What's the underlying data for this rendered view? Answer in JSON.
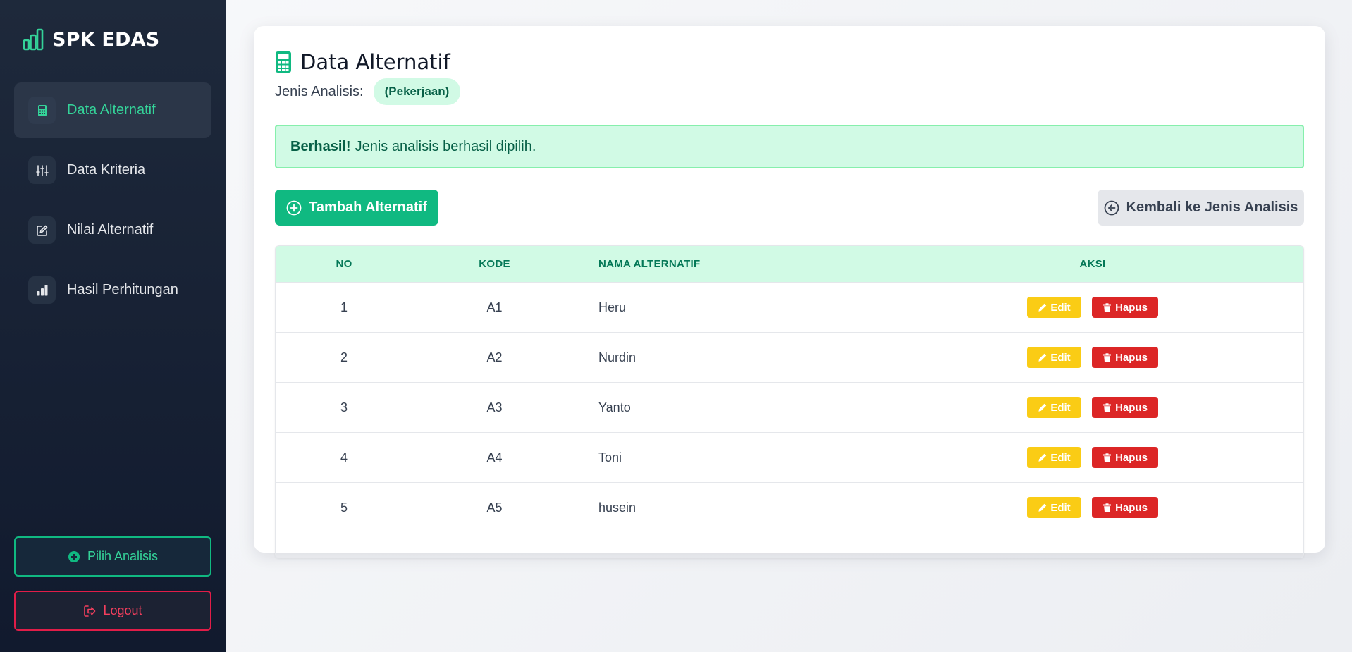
{
  "brand": {
    "name": "SPK EDAS",
    "icon": "bar-chart-icon"
  },
  "sidebar": {
    "items": [
      {
        "label": "Data Alternatif",
        "icon": "calculator-icon",
        "active": true
      },
      {
        "label": "Data Kriteria",
        "icon": "sliders-icon",
        "active": false
      },
      {
        "label": "Nilai Alternatif",
        "icon": "edit-icon",
        "active": false
      },
      {
        "label": "Hasil Perhitungan",
        "icon": "chart-bar-icon",
        "active": false
      }
    ],
    "pilih_label": "Pilih Analisis",
    "logout_label": "Logout"
  },
  "main": {
    "title": "Data Alternatif",
    "jenis_label": "Jenis Analisis:",
    "jenis_value": "(Pekerjaan)",
    "alert_strong": "Berhasil!",
    "alert_text": "Jenis analisis berhasil dipilih.",
    "tambah_label": "Tambah Alternatif",
    "kembali_label": "Kembali ke Jenis Analisis"
  },
  "table": {
    "headers": {
      "no": "NO",
      "kode": "KODE",
      "nama": "NAMA ALTERNATIF",
      "aksi": "AKSI"
    },
    "rows": [
      {
        "no": "1",
        "kode": "A1",
        "nama": "Heru"
      },
      {
        "no": "2",
        "kode": "A2",
        "nama": "Nurdin"
      },
      {
        "no": "3",
        "kode": "A3",
        "nama": "Yanto"
      },
      {
        "no": "4",
        "kode": "A4",
        "nama": "Toni"
      },
      {
        "no": "5",
        "kode": "A5",
        "nama": "husein"
      }
    ],
    "edit_label": "Edit",
    "hapus_label": "Hapus"
  },
  "colors": {
    "accent": "#10b981",
    "sidebar_bg": "#1e293b",
    "table_header_bg": "#d1fae5",
    "edit": "#facc15",
    "delete": "#dc2626",
    "logout": "#e11d48"
  }
}
